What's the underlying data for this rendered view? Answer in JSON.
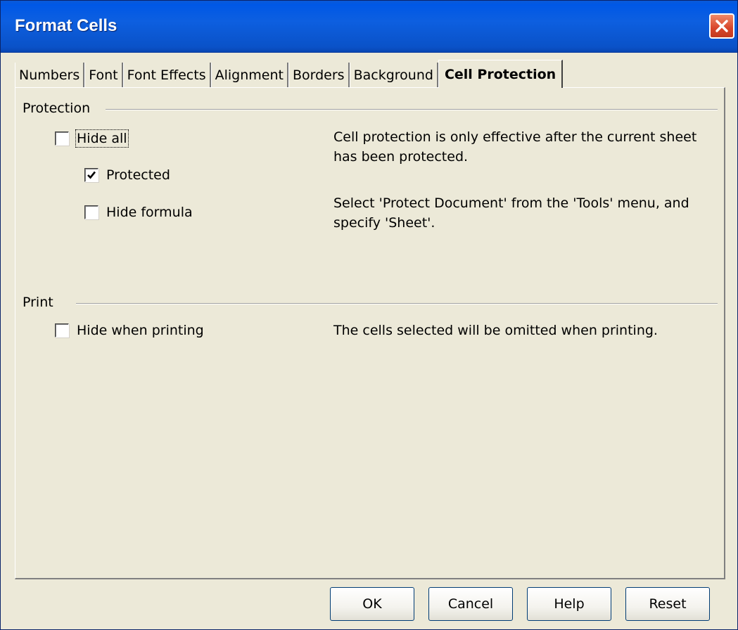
{
  "window": {
    "title": "Format Cells"
  },
  "tabs": [
    {
      "label": "Numbers"
    },
    {
      "label": "Font"
    },
    {
      "label": "Font Effects"
    },
    {
      "label": "Alignment"
    },
    {
      "label": "Borders"
    },
    {
      "label": "Background"
    },
    {
      "label": "Cell Protection",
      "active": true
    }
  ],
  "protection": {
    "section_label": "Protection",
    "hide_all": {
      "label": "Hide all",
      "checked": false
    },
    "protected": {
      "label": "Protected",
      "checked": true
    },
    "hide_formula": {
      "label": "Hide formula",
      "checked": false
    },
    "info_line1": "Cell protection is only effective after the current sheet has been protected.",
    "info_line2": "Select 'Protect Document' from the 'Tools' menu, and specify 'Sheet'."
  },
  "print": {
    "section_label": "Print",
    "hide_when_printing": {
      "label": "Hide when printing",
      "checked": false
    },
    "info": "The cells selected will be omitted when printing."
  },
  "buttons": {
    "ok": "OK",
    "cancel": "Cancel",
    "help": "Help",
    "reset": "Reset"
  },
  "colors": {
    "titlebar": "#0058e6",
    "dialog_bg": "#ece9d8",
    "close_button": "#d8452a"
  }
}
